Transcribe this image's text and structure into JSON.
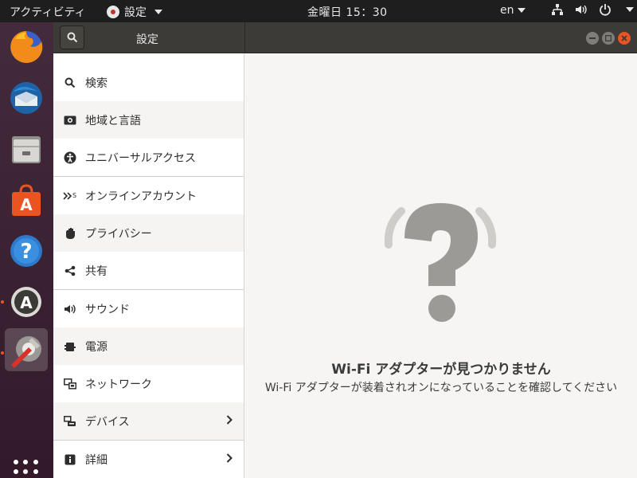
{
  "topbar": {
    "activities": "アクティビティ",
    "app_menu": "設定",
    "clock": "金曜日 15：30",
    "lang": "en"
  },
  "dock": {
    "items": [
      {
        "name": "firefox-icon"
      },
      {
        "name": "thunderbird-icon"
      },
      {
        "name": "files-icon"
      },
      {
        "name": "software-center-icon"
      },
      {
        "name": "help-icon"
      },
      {
        "name": "software-updater-icon"
      },
      {
        "name": "settings-icon"
      }
    ]
  },
  "window": {
    "title": "設定"
  },
  "sidebar": {
    "items": [
      {
        "label": "検索",
        "icon": "search-icon"
      },
      {
        "label": "地域と言語",
        "icon": "region-icon"
      },
      {
        "label": "ユニバーサルアクセス",
        "icon": "accessibility-icon"
      },
      {
        "label": "オンラインアカウント",
        "icon": "online-accounts-icon"
      },
      {
        "label": "プライバシー",
        "icon": "privacy-hand-icon"
      },
      {
        "label": "共有",
        "icon": "share-icon"
      },
      {
        "label": "サウンド",
        "icon": "speaker-icon"
      },
      {
        "label": "電源",
        "icon": "power-plug-icon"
      },
      {
        "label": "ネットワーク",
        "icon": "network-icon"
      },
      {
        "label": "デバイス",
        "icon": "devices-icon"
      },
      {
        "label": "詳細",
        "icon": "info-icon"
      }
    ]
  },
  "content": {
    "empty_title": "Wi-Fi アダプターが見つかりません",
    "empty_subtitle": "Wi-Fi アダプターが装着されオンになっていることを確認してください"
  },
  "colors": {
    "accent": "#e95420",
    "header": "#3c3b37",
    "dock": "#3c1f32"
  }
}
